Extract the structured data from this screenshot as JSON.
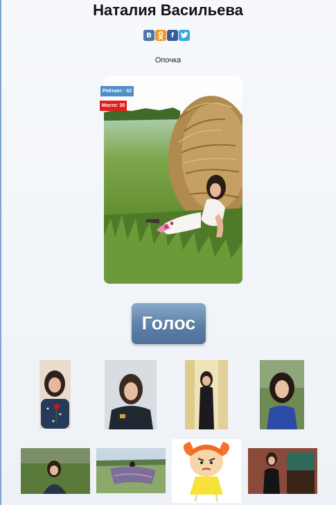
{
  "profile": {
    "name": "Наталия Васильева",
    "city": "Опочка"
  },
  "share": {
    "vk": "В",
    "ok": "ok",
    "fb": "f",
    "tw": "t"
  },
  "photo": {
    "rating": "Рейтинг: -32",
    "place": "Место: 35"
  },
  "vote_label": "Голос",
  "colors": {
    "vk": "#4a76a8",
    "ok": "#f29a27",
    "fb": "#3b5998",
    "tw": "#34a9dc",
    "rating_badge": "#4f8fc6",
    "place_badge": "#e0201e",
    "vote_button": "#5d80a8"
  },
  "icons": [
    "vk-icon",
    "odnoklassniki-icon",
    "facebook-icon",
    "twitter-icon"
  ],
  "gallery": {
    "thumbs": [
      "thumb-woman-rose",
      "thumb-woman-uniform",
      "thumb-woman-black-dress",
      "thumb-woman-blue-dress",
      "thumb-woman-hay",
      "thumb-woman-field-scarf",
      "thumb-cartoon-girl",
      "thumb-woman-aquarium"
    ]
  }
}
